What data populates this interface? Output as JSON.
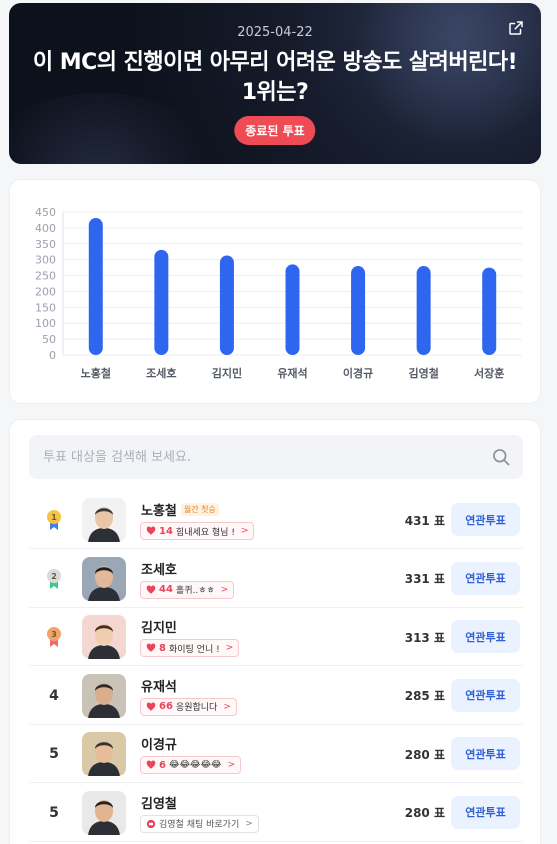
{
  "hero": {
    "date": "2025-04-22",
    "title": "이 MC의 진행이면 아무리 어려운 방송도 살려버린다! 1위는?",
    "status": "종료된 투표"
  },
  "search": {
    "placeholder": "투표 대상을 검색해 보세요."
  },
  "chart_data": {
    "type": "bar",
    "categories": [
      "노홍철",
      "조세호",
      "김지민",
      "유재석",
      "이경규",
      "김영철",
      "서장훈"
    ],
    "values": [
      431,
      331,
      313,
      285,
      280,
      280,
      275
    ],
    "ylim": [
      0,
      450
    ],
    "yticks": [
      0,
      50,
      100,
      150,
      200,
      250,
      300,
      350,
      400,
      450
    ],
    "bar_color": "#2f66f0",
    "grid": true
  },
  "candidates": [
    {
      "rank": "1",
      "medal": "gold",
      "name": "노홍철",
      "tag": "월간 첫승",
      "cheer_count": "14",
      "cheer_text": "힘내세요 형님 !",
      "votes": "431 표",
      "button": "연관투표"
    },
    {
      "rank": "2",
      "medal": "silver",
      "name": "조세호",
      "tag": "",
      "cheer_count": "44",
      "cheer_text": "홀퀴..ㅎㅎ",
      "votes": "331 표",
      "button": "연관투표"
    },
    {
      "rank": "3",
      "medal": "bronze",
      "name": "김지민",
      "tag": "",
      "cheer_count": "8",
      "cheer_text": "화이팅 언니 !",
      "votes": "313 표",
      "button": "연관투표"
    },
    {
      "rank": "4",
      "medal": "",
      "name": "유재석",
      "tag": "",
      "cheer_count": "66",
      "cheer_text": "응원합니다",
      "votes": "285 표",
      "button": "연관투표"
    },
    {
      "rank": "5",
      "medal": "",
      "name": "이경규",
      "tag": "",
      "cheer_count": "6",
      "cheer_text": "😂😂😂😂😂",
      "votes": "280 표",
      "button": "연관투표"
    },
    {
      "rank": "5",
      "medal": "",
      "name": "김영철",
      "tag": "",
      "cheer_count": "",
      "cheer_text": "김영철 채팅 바로가기",
      "votes": "280 표",
      "button": "연관투표"
    }
  ],
  "colors": {
    "accent": "#2f66f0",
    "badge": "#ef4b55",
    "heart": "#e8445a"
  }
}
